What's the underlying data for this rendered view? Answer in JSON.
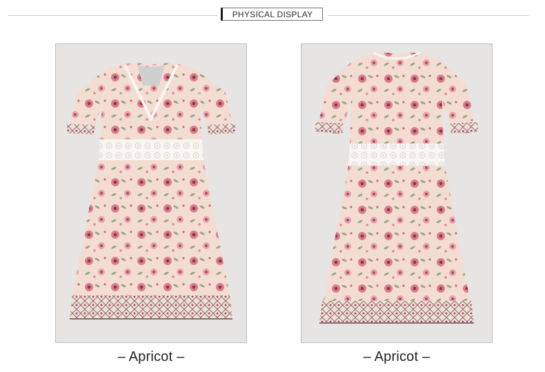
{
  "header": {
    "title": "PHYSICAL DISPLAY"
  },
  "panels": [
    {
      "view": "front-v-neck",
      "caption": "– Apricot –"
    },
    {
      "view": "front-round-neck",
      "caption": "– Apricot –"
    }
  ],
  "colors": {
    "fabric": "#f3ddd2",
    "floral_pink": "#d86c83",
    "floral_deep": "#b24a5e",
    "leaf_green": "#9aa883",
    "lace": "#f8f6f2",
    "background": "#e6e5e3"
  }
}
